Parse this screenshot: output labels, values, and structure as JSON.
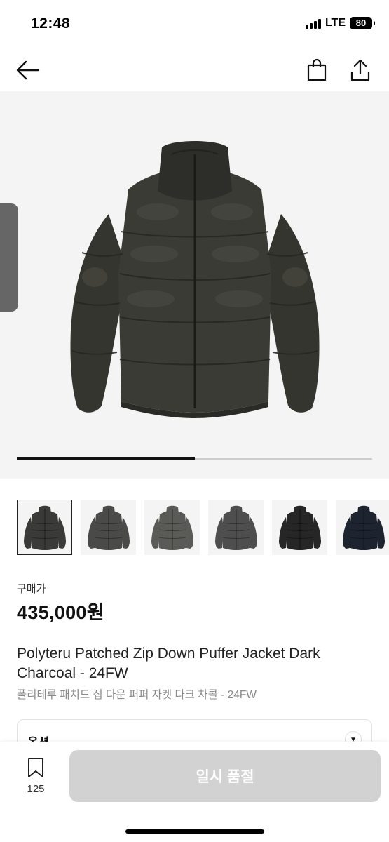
{
  "status_bar": {
    "time": "12:48",
    "network": "LTE",
    "battery": "80"
  },
  "nav": {
    "back_icon": "arrow-left-icon",
    "bag_icon": "shopping-bag-icon",
    "share_icon": "share-icon"
  },
  "gallery": {
    "progress": 0.5,
    "thumbnail_count": 6,
    "selected_index": 0,
    "thumbnail_colors": [
      "#3a3a38",
      "#4a4a48",
      "#5a5a56",
      "#4e4e4e",
      "#262626",
      "#1e2330"
    ]
  },
  "product": {
    "price_label": "구매가",
    "price": "435,000원",
    "title_en": "Polyteru Patched Zip Down Puffer Jacket Dark Charcoal - 24FW",
    "title_ko": "폴리테루 패치드 집 다운 퍼퍼 자켓 다크 차콜 - 24FW"
  },
  "option": {
    "label": "옵션"
  },
  "bottom_bar": {
    "bookmark_count": "125",
    "soldout_label": "일시 품절"
  }
}
